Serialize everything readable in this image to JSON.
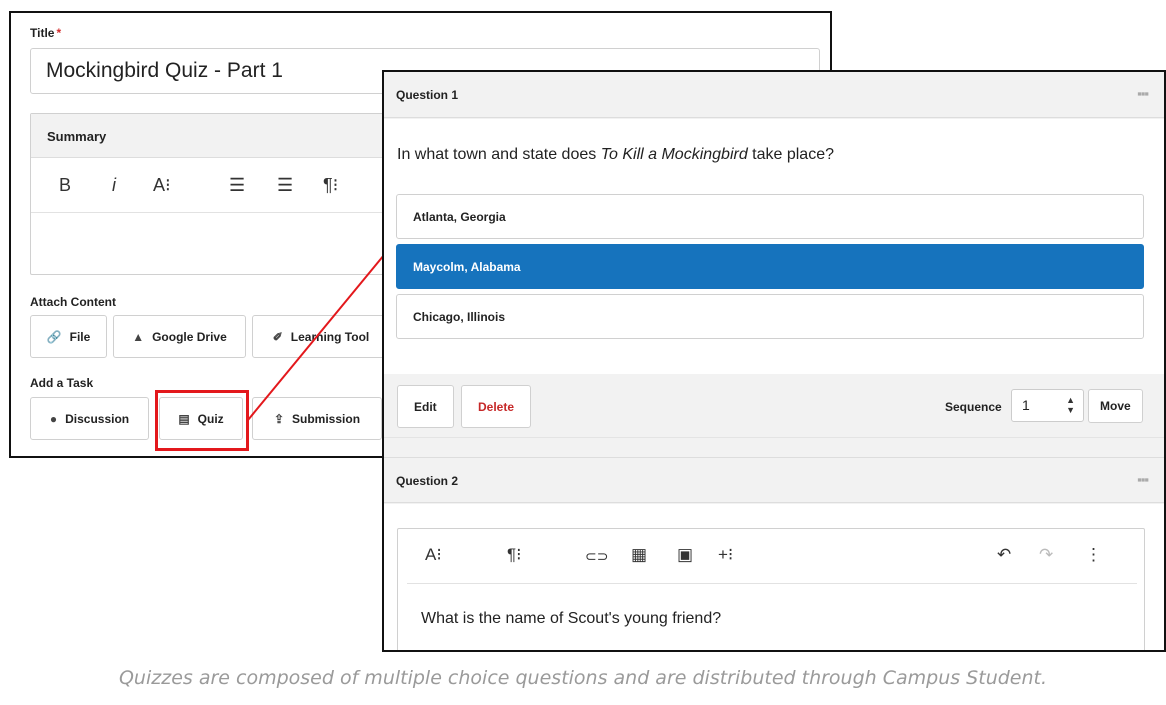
{
  "form": {
    "title_label": "Title",
    "required_mark": "*",
    "title_value": "Mockingbird Quiz - Part 1",
    "summary_label": "Summary",
    "summary_toolbar": {
      "bold": "B",
      "italic": "i",
      "font_size": "A⁝",
      "align_left": "☰",
      "align_center": "☰",
      "paragraph": "¶⁝"
    },
    "attach_label": "Attach Content",
    "attach_buttons": [
      {
        "label": "File",
        "icon": "paperclip-icon",
        "glyph": "🔗"
      },
      {
        "label": "Google Drive",
        "icon": "google-drive-icon",
        "glyph": "▲"
      },
      {
        "label": "Learning Tool",
        "icon": "plug-icon",
        "glyph": "✐"
      }
    ],
    "task_label": "Add a Task",
    "task_buttons": [
      {
        "label": "Discussion",
        "icon": "comments-icon",
        "glyph": "●"
      },
      {
        "label": "Quiz",
        "icon": "list-icon",
        "glyph": "▤"
      },
      {
        "label": "Submission",
        "icon": "upload-icon",
        "glyph": "⇪"
      }
    ]
  },
  "question1": {
    "header": "Question 1",
    "grip_glyph": "▪▪▪",
    "text_before": "In what town and state does ",
    "text_italic": "To Kill a Mockingbird",
    "text_after": " take place?",
    "options": [
      {
        "label": "Atlanta, Georgia",
        "selected": false
      },
      {
        "label": "Maycolm, Alabama",
        "selected": true
      },
      {
        "label": "Chicago, Illinois",
        "selected": false
      }
    ],
    "edit_label": "Edit",
    "delete_label": "Delete",
    "sequence_label": "Sequence",
    "sequence_value": "1",
    "move_label": "Move"
  },
  "question2": {
    "header": "Question 2",
    "grip_glyph": "▪▪▪",
    "toolbar": {
      "font_size": "A⁝",
      "paragraph": "¶⁝",
      "link": "⊂⊃",
      "table": "▦",
      "image": "▣",
      "insert": "+⁝",
      "undo": "↶",
      "redo": "↷",
      "more": "⋮"
    },
    "text": "What is the name of Scout's young friend?"
  },
  "caption": "Quizzes are composed of multiple choice questions and are distributed through Campus Student.",
  "colors": {
    "selected_option": "#1673bd",
    "highlight": "#e3181c",
    "delete_text": "#c62828",
    "required": "#d32f2f"
  }
}
